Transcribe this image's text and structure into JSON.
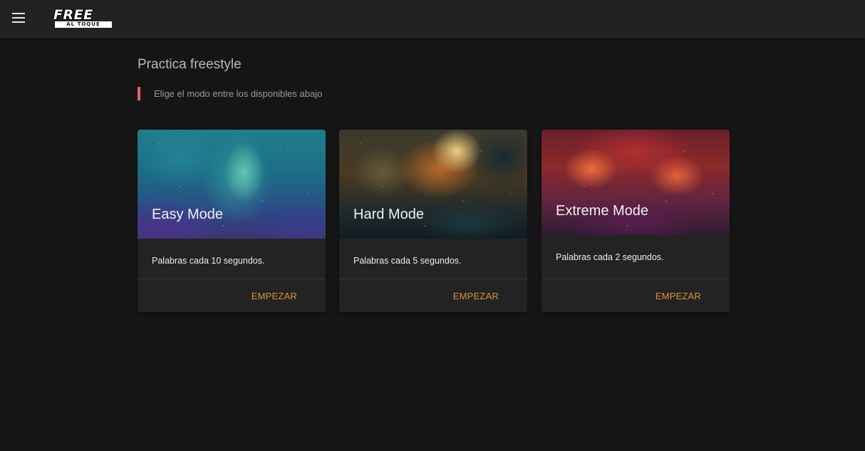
{
  "header": {
    "menu_icon": "menu-icon",
    "logo_big": "FREE",
    "logo_small": "AL TOQUE"
  },
  "main": {
    "title": "Practica freestyle",
    "subtitle": "Elige el modo entre los disponibles abajo",
    "accent_color": "#e36464"
  },
  "cards": [
    {
      "title": "Easy Mode",
      "description": "Palabras cada 10 segundos.",
      "action": "EMPEZAR"
    },
    {
      "title": "Hard Mode",
      "description": "Palabras cada 5 segundos.",
      "action": "EMPEZAR"
    },
    {
      "title": "Extreme Mode",
      "description": "Palabras cada 2 segundos.",
      "action": "EMPEZAR"
    }
  ],
  "colors": {
    "background": "#151515",
    "topbar": "#222222",
    "card": "#232323",
    "action": "#e0913a"
  }
}
